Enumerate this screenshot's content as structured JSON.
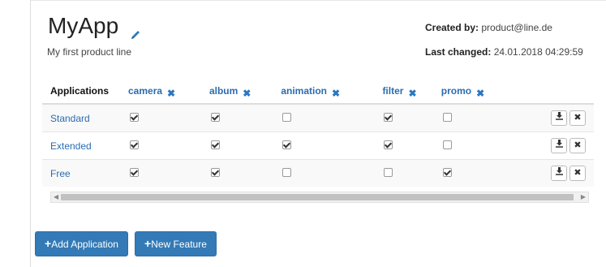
{
  "header": {
    "app_name": "MyApp",
    "description": "My first product line",
    "created_by_label": "Created by:",
    "created_by_value": "product@line.de",
    "last_changed_label": "Last changed:",
    "last_changed_value": "24.01.2018 04:29:59"
  },
  "table": {
    "applications_header": "Applications",
    "features": [
      "camera",
      "album",
      "animation",
      "filter",
      "promo"
    ],
    "rows": [
      {
        "name": "Standard",
        "checks": [
          true,
          true,
          false,
          true,
          false
        ]
      },
      {
        "name": "Extended",
        "checks": [
          true,
          true,
          true,
          true,
          false
        ]
      },
      {
        "name": "Free",
        "checks": [
          true,
          true,
          false,
          false,
          true
        ]
      }
    ]
  },
  "buttons": {
    "add_application": "Add Application",
    "new_feature": "New Feature"
  },
  "icons": {
    "edit": "pencil-icon",
    "remove_feature": "close-icon",
    "download": "download-icon",
    "delete": "close-icon"
  },
  "colors": {
    "accent": "#337ab7",
    "link": "#2b6cb0"
  }
}
